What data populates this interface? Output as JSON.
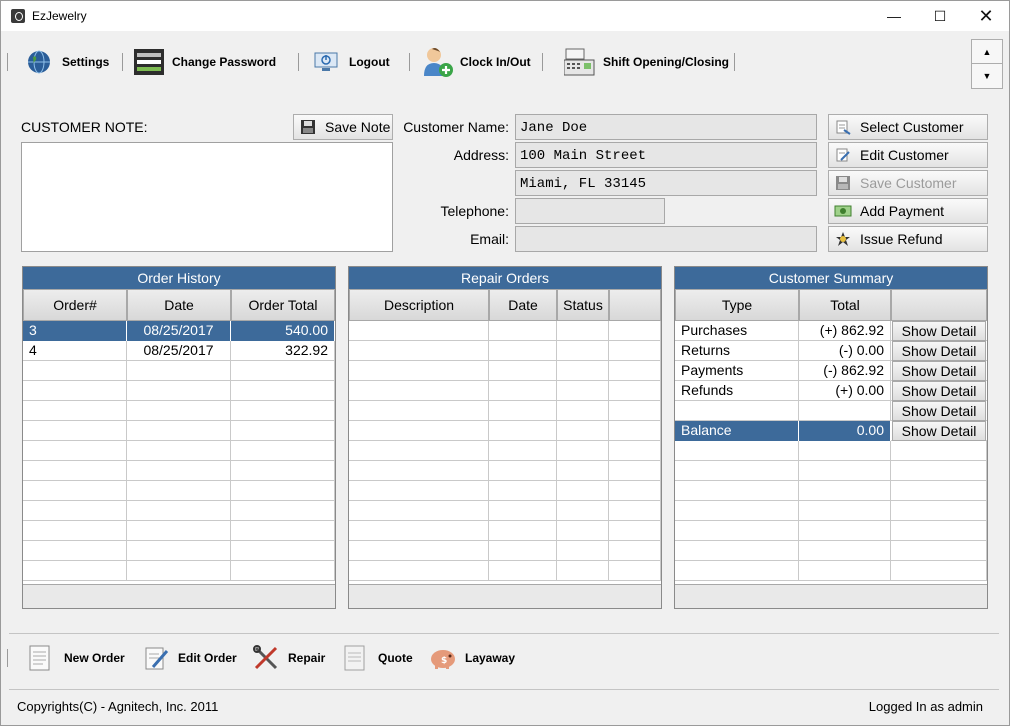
{
  "window": {
    "title": "EzJewelry"
  },
  "toolbar": {
    "items": [
      {
        "label": "Settings",
        "icon": "globe-icon"
      },
      {
        "label": "Change Password",
        "icon": "password-screen-icon"
      },
      {
        "label": "Logout",
        "icon": "monitor-power-icon"
      },
      {
        "label": "Clock In/Out",
        "icon": "user-add-icon"
      },
      {
        "label": "Shift Opening/Closing",
        "icon": "cash-register-icon"
      }
    ]
  },
  "note": {
    "label": "CUSTOMER NOTE:",
    "save_label": "Save Note",
    "value": ""
  },
  "customer": {
    "name_label": "Customer Name:",
    "name": "Jane Doe",
    "address_label": "Address:",
    "address1": "100 Main Street",
    "address2": "Miami, FL 33145",
    "telephone_label": "Telephone:",
    "telephone": "",
    "email_label": "Email:",
    "email": ""
  },
  "actions": {
    "select": "Select Customer",
    "edit": "Edit Customer",
    "save": "Save Customer",
    "add_payment": "Add Payment",
    "issue_refund": "Issue Refund"
  },
  "order_history": {
    "title": "Order History",
    "columns": [
      "Order#",
      "Date",
      "Order Total"
    ],
    "rows": [
      {
        "order": "3",
        "date": "08/25/2017",
        "total": "540.00"
      },
      {
        "order": "4",
        "date": "08/25/2017",
        "total": "322.92"
      }
    ]
  },
  "repair_orders": {
    "title": "Repair Orders",
    "columns": [
      "Description",
      "Date",
      "Status"
    ]
  },
  "summary": {
    "title": "Customer Summary",
    "columns": [
      "Type",
      "Total"
    ],
    "detail_label": "Show Detail",
    "rows": [
      {
        "type": "Purchases",
        "total": "(+) 862.92"
      },
      {
        "type": "Returns",
        "total": "(-) 0.00"
      },
      {
        "type": "Payments",
        "total": "(-) 862.92"
      },
      {
        "type": "Refunds",
        "total": "(+) 0.00"
      },
      {
        "type": "",
        "total": ""
      },
      {
        "type": "Balance",
        "total": "0.00"
      }
    ]
  },
  "bottom": {
    "items": [
      {
        "label": "New Order",
        "icon": "document-icon"
      },
      {
        "label": "Edit Order",
        "icon": "edit-document-icon"
      },
      {
        "label": "Repair",
        "icon": "tools-icon"
      },
      {
        "label": "Quote",
        "icon": "quote-document-icon"
      },
      {
        "label": "Layaway",
        "icon": "piggy-bank-icon"
      }
    ]
  },
  "status": {
    "copyright": "Copyrights(C) - Agnitech, Inc. 2011",
    "login": "Logged In as admin"
  },
  "colors": {
    "header_blue": "#3d6a9a"
  }
}
